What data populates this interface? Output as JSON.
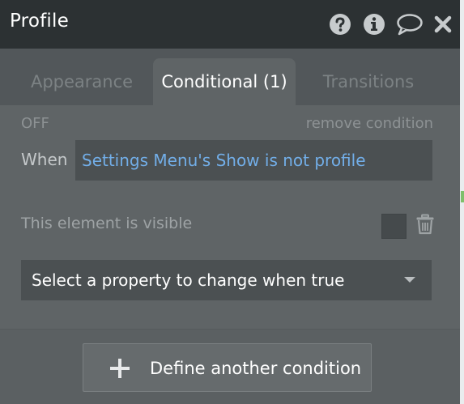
{
  "window": {
    "title": "Profile",
    "icons": [
      "help-icon",
      "info-icon",
      "comment-icon",
      "close-icon"
    ]
  },
  "tabs": [
    {
      "label": "Appearance",
      "active": false
    },
    {
      "label": "Conditional (1)",
      "active": true
    },
    {
      "label": "Transitions",
      "active": false
    }
  ],
  "condition": {
    "status": "OFF",
    "remove_label": "remove condition",
    "when_label": "When",
    "expression": "Settings Menu's Show is not profile",
    "property_label": "This element is visible",
    "property_checked": false,
    "select_placeholder": "Select a property to change when true"
  },
  "footer": {
    "define_label": "Define another condition"
  },
  "colors": {
    "titlebar": "#2c3133",
    "panel": "#5f6466",
    "expression_text": "#72aee8"
  }
}
